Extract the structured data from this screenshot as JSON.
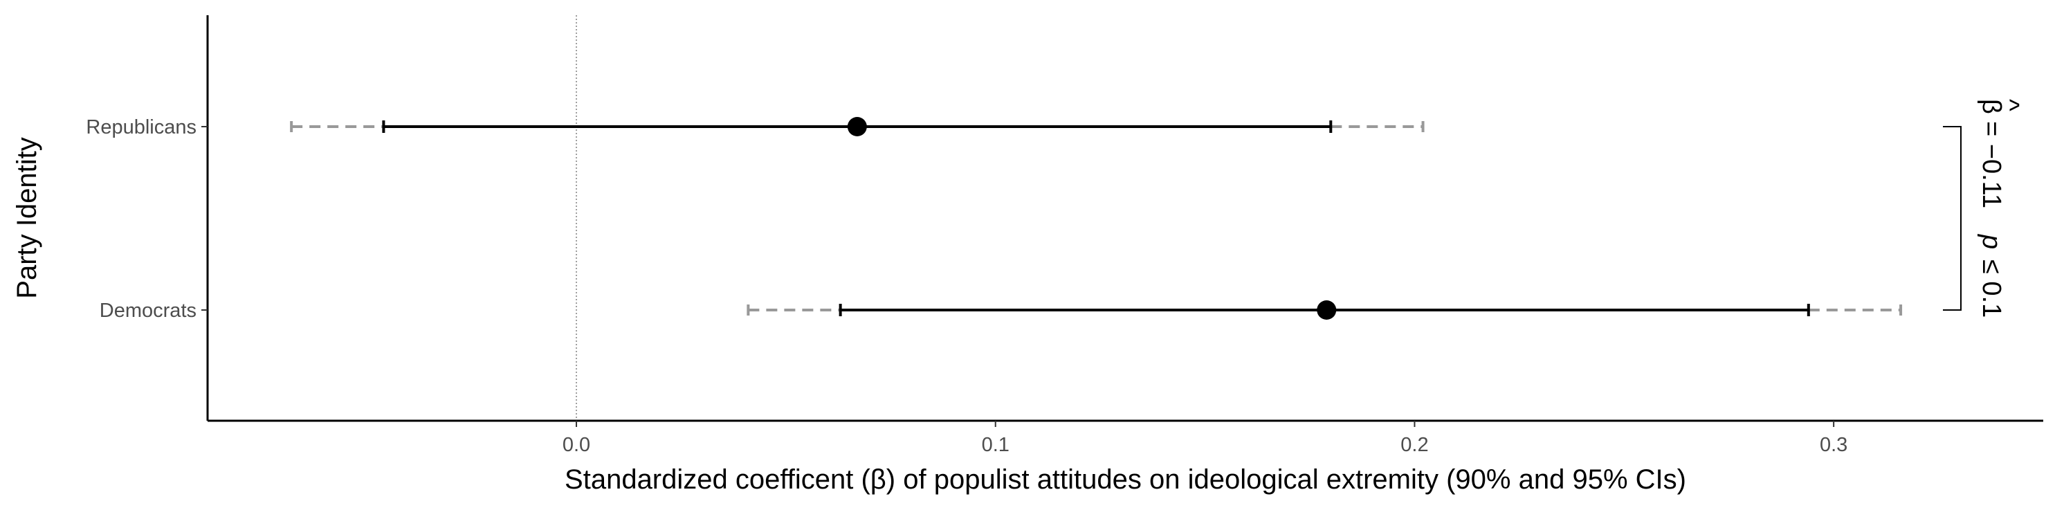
{
  "chart_data": {
    "type": "coefficient-plot",
    "xlabel": "Standardized coefficent (β) of populist attitudes on ideological extremity (90% and 95% CIs)",
    "ylabel": "Party Identity",
    "x_ticks": [
      0.0,
      0.1,
      0.2,
      0.3
    ],
    "x_tick_labels": [
      "0.0",
      "0.1",
      "0.2",
      "0.3"
    ],
    "xlim": [
      -0.088,
      0.35
    ],
    "reference_line": 0,
    "categories": [
      "Republicans",
      "Democrats"
    ],
    "series": [
      {
        "category": "Republicans",
        "estimate": 0.067,
        "ci90": [
          -0.046,
          0.18
        ],
        "ci95": [
          -0.068,
          0.202
        ]
      },
      {
        "category": "Democrats",
        "estimate": 0.179,
        "ci90": [
          0.063,
          0.294
        ],
        "ci95": [
          0.041,
          0.316
        ]
      }
    ],
    "annotation": {
      "beta_hat": "β",
      "hat": "^",
      "value": "= −0.11",
      "p_symbol": "p",
      "p_value": "≤ 0.1"
    },
    "colors": {
      "ci90": "#000000",
      "ci95": "#999999",
      "point": "#000000",
      "axis": "#000000",
      "refline": "#7f7f7f"
    },
    "grid": false
  }
}
